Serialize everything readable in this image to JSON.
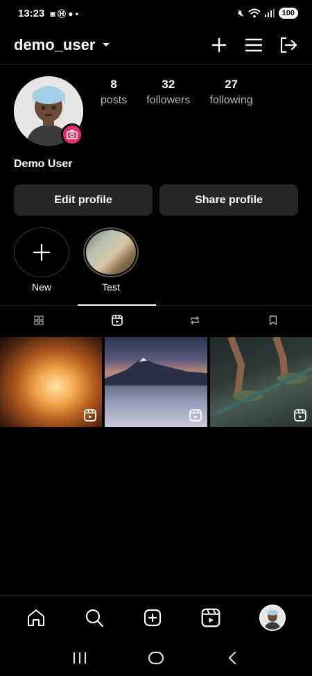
{
  "status_bar": {
    "time": "13:23",
    "battery": "100"
  },
  "header": {
    "username": "demo_user"
  },
  "profile": {
    "display_name": "Demo User",
    "stats": [
      {
        "value": "8",
        "label": "posts"
      },
      {
        "value": "32",
        "label": "followers"
      },
      {
        "value": "27",
        "label": "following"
      }
    ]
  },
  "buttons": {
    "edit": "Edit profile",
    "share": "Share profile"
  },
  "highlights": [
    {
      "label": "New"
    },
    {
      "label": "Test"
    }
  ],
  "tabs": [
    "grid-icon",
    "reels-icon",
    "reposts-icon",
    "saved-icon"
  ],
  "colors": {
    "accent": "#e1306c",
    "button_bg": "#262626",
    "secondary_text": "#b5b5b5"
  }
}
